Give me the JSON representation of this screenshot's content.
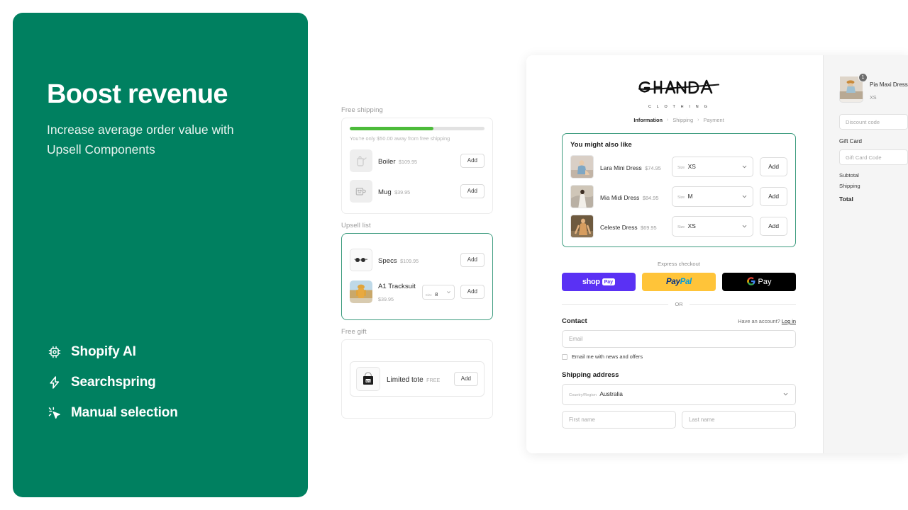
{
  "hero": {
    "title": "Boost revenue",
    "subtitle": "Increase average order value with Upsell Components",
    "features": [
      {
        "icon": "chip-ai-icon",
        "label": "Shopify AI"
      },
      {
        "icon": "lightning-bolt-icon",
        "label": "Searchspring"
      },
      {
        "icon": "cursor-sparkle-icon",
        "label": "Manual selection"
      }
    ]
  },
  "components": {
    "free_shipping": {
      "caption": "Free shipping",
      "progress_percent": 62,
      "progress_note": "You're only $50.00 away from free shipping",
      "items": [
        {
          "name": "Boiler",
          "price": "$109.95",
          "add_label": "Add",
          "thumb": "kettle-thumbnail"
        },
        {
          "name": "Mug",
          "price": "$39.95",
          "add_label": "Add",
          "thumb": "mug-thumbnail"
        }
      ]
    },
    "upsell_list": {
      "caption": "Upsell list",
      "items": [
        {
          "name": "Specs",
          "price": "$109.95",
          "add_label": "Add",
          "thumb": "glasses-thumbnail",
          "has_size": false
        },
        {
          "name": "A1 Tracksuit",
          "price": "$39.95",
          "add_label": "Add",
          "thumb": "tracksuit-thumbnail",
          "has_size": true,
          "size_label": "Size",
          "size_value": "8"
        }
      ]
    },
    "free_gift": {
      "caption": "Free gift",
      "items": [
        {
          "name": "Limited tote",
          "price": "FREE",
          "add_label": "Add",
          "thumb": "tote-bag-thumbnail"
        }
      ]
    }
  },
  "checkout": {
    "brand": {
      "name": "GHANDA",
      "tagline": "C L O T H I N G"
    },
    "breadcrumbs": [
      {
        "label": "Information",
        "active": true
      },
      {
        "label": "Shipping",
        "active": false
      },
      {
        "label": "Payment",
        "active": false
      }
    ],
    "breadcrumb_separator": "›",
    "upsell": {
      "title": "You might also like",
      "items": [
        {
          "name": "Lara Mini Dress",
          "price": "$74.95",
          "size_label": "Size",
          "size_value": "XS",
          "add_label": "Add",
          "thumb": "lara-mini-dress-thumbnail"
        },
        {
          "name": "Mia Midi Dress",
          "price": "$84.95",
          "size_label": "Size",
          "size_value": "M",
          "add_label": "Add",
          "thumb": "mia-midi-dress-thumbnail"
        },
        {
          "name": "Celeste Dress",
          "price": "$69.95",
          "size_label": "Size",
          "size_value": "XS",
          "add_label": "Add",
          "thumb": "celeste-dress-thumbnail"
        }
      ]
    },
    "express": {
      "label": "Express checkout",
      "shop_pay": {
        "word": "shop",
        "chip": "Pay"
      },
      "paypal": {
        "first": "Pay",
        "second": "Pal"
      },
      "gpay": {
        "g": "G",
        "word": "Pay"
      },
      "divider": "OR"
    },
    "contact": {
      "title": "Contact",
      "account_prompt": "Have an account?",
      "login_label": "Log in",
      "email_placeholder": "Email",
      "newsletter_label": "Email me with news and offers"
    },
    "shipping_address": {
      "title": "Shipping address",
      "country_label": "Country/Region",
      "country_value": "Australia",
      "first_name_placeholder": "First name",
      "last_name_placeholder": "Last name"
    },
    "summary": {
      "item": {
        "name": "Pia Maxi Dress",
        "variant": "XS",
        "quantity": "1",
        "thumb": "pia-maxi-dress-thumbnail"
      },
      "discount_placeholder": "Discount code",
      "gift_card_label": "Gift Card",
      "gift_card_placeholder": "Gift Card Code",
      "subtotal_label": "Subtotal",
      "shipping_label": "Shipping",
      "total_label": "Total"
    }
  },
  "colors": {
    "brand_green": "#008060",
    "accent_teal": "#3f9d80",
    "progress_green": "#4cbb3a",
    "shop_pay_purple": "#5a31f4",
    "paypal_yellow": "#ffc439",
    "gpay_black": "#000000"
  }
}
